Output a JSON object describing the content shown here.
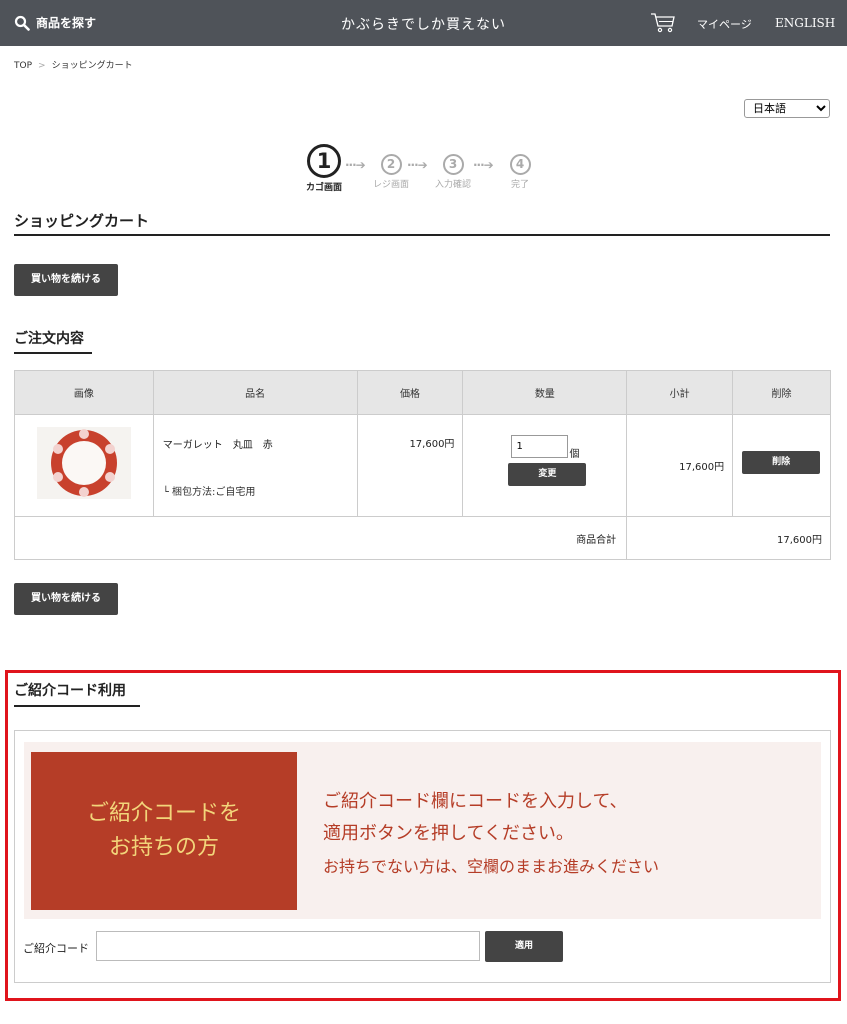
{
  "header": {
    "search_label": "商品を探す",
    "site_title": "かぶらきでしか買えない",
    "mypage_label": "マイページ",
    "english_label": "ENGLISH"
  },
  "breadcrumb": {
    "items": [
      "TOP",
      "ショッピングカート"
    ],
    "separator": ">"
  },
  "language": {
    "selected": "日本語"
  },
  "steps": [
    {
      "number": "1",
      "label": "カゴ画面"
    },
    {
      "number": "2",
      "label": "レジ画面"
    },
    {
      "number": "3",
      "label": "入力確認"
    },
    {
      "number": "4",
      "label": "完了"
    }
  ],
  "page_title": "ショッピングカート",
  "continue_shopping_label": "買い物を続ける",
  "order": {
    "section_title": "ご注文内容",
    "columns": [
      "画像",
      "品名",
      "価格",
      "数量",
      "小計",
      "削除"
    ],
    "items": [
      {
        "name": "マーガレット　丸皿　赤",
        "wrap_method": "└ 梱包方法:ご自宅用",
        "price": "17,600円",
        "quantity": "1",
        "quantity_unit": "個",
        "change_label": "変更",
        "subtotal": "17,600円",
        "delete_label": "削除"
      }
    ],
    "total_label": "商品合計",
    "total_value": "17,600円"
  },
  "referral": {
    "section_title": "ご紹介コード利用",
    "banner_left_line1": "ご紹介コードを",
    "banner_left_line2": "お持ちの方",
    "banner_right_line1": "ご紹介コード欄にコードを入力して、",
    "banner_right_line2": "適用ボタンを押してください。",
    "banner_right_line3": "お持ちでない方は、空欄のままお進みください",
    "code_label": "ご紹介コード",
    "code_value": "",
    "apply_label": "適用"
  },
  "colors": {
    "header_bg": "#4f5359",
    "button_bg": "#444444",
    "banner_red": "#b53d27",
    "banner_gold": "#f2d57a",
    "highlight_frame": "#e0141c"
  }
}
